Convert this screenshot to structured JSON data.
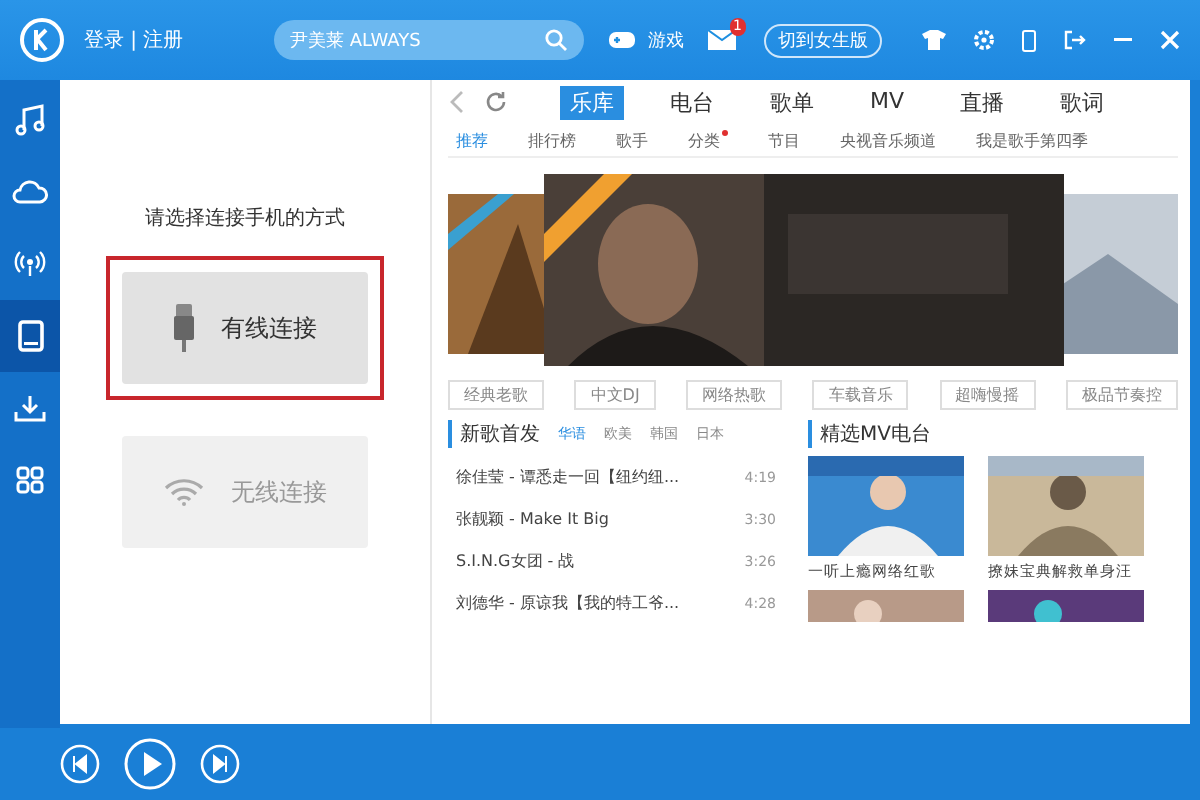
{
  "title_bar": {
    "login": "登录 | 注册",
    "search": {
      "value": "尹美莱 ALWAYS"
    },
    "game": "游戏",
    "mail_badge": "1",
    "switch": "切到女生版"
  },
  "sidebar": {
    "items": [
      {
        "selected": false
      },
      {
        "selected": false
      },
      {
        "selected": false
      },
      {
        "selected": true
      },
      {
        "selected": false
      },
      {
        "selected": false
      }
    ]
  },
  "connect": {
    "prompt": "请选择连接手机的方式",
    "options": [
      {
        "kind": "usb",
        "label": "有线连接",
        "selected": true
      },
      {
        "kind": "wifi",
        "label": "无线连接",
        "selected": false
      }
    ]
  },
  "nav": {
    "tabs": [
      {
        "label": "乐库",
        "selected": true
      },
      {
        "label": "电台",
        "selected": false
      },
      {
        "label": "歌单",
        "selected": false
      },
      {
        "label": "MV",
        "selected": false
      },
      {
        "label": "直播",
        "selected": false
      },
      {
        "label": "歌词",
        "selected": false
      }
    ],
    "subtabs": [
      {
        "label": "推荐",
        "selected": true,
        "dot": false
      },
      {
        "label": "排行榜",
        "selected": false,
        "dot": false
      },
      {
        "label": "歌手",
        "selected": false,
        "dot": false
      },
      {
        "label": "分类",
        "selected": false,
        "dot": true
      },
      {
        "label": "节目",
        "selected": false,
        "dot": false
      },
      {
        "label": "央视音乐频道",
        "selected": false,
        "dot": false
      },
      {
        "label": "我是歌手第四季",
        "selected": false,
        "dot": false
      }
    ]
  },
  "tags": [
    "经典老歌",
    "中文DJ",
    "网络热歌",
    "车载音乐",
    "超嗨慢摇",
    "极品节奏控"
  ],
  "new_songs": {
    "title": "新歌首发",
    "regions": [
      {
        "label": "华语",
        "selected": true
      },
      {
        "label": "欧美",
        "selected": false
      },
      {
        "label": "韩国",
        "selected": false
      },
      {
        "label": "日本",
        "selected": false
      }
    ],
    "songs": [
      {
        "title": "徐佳莹 - 谭悉走一回【纽约纽...",
        "duration": "4:19"
      },
      {
        "title": "张靓颖 - Make It Big",
        "duration": "3:30"
      },
      {
        "title": "S.I.N.G女团 - 战",
        "duration": "3:26"
      },
      {
        "title": "刘德华 - 原谅我【我的特工爷...",
        "duration": "4:28"
      }
    ]
  },
  "mv_radio": {
    "title": "精选MV电台",
    "items": [
      {
        "caption": "一听上瘾网络红歌"
      },
      {
        "caption": "撩妹宝典解救单身汪"
      }
    ]
  }
}
